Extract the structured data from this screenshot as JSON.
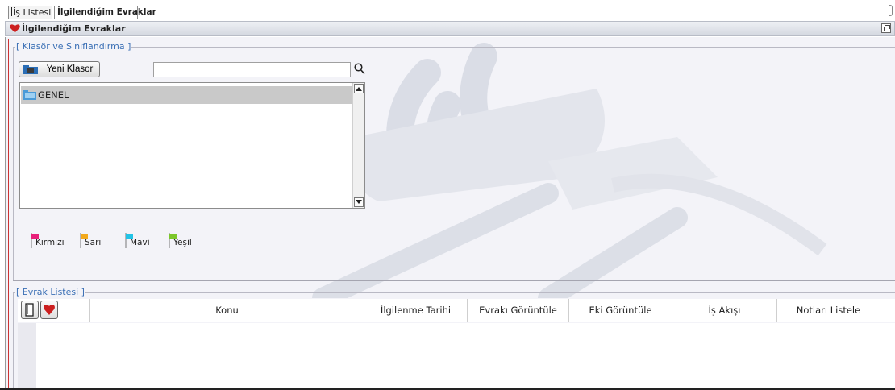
{
  "tabs": [
    {
      "label": "İş Listesi",
      "active": false
    },
    {
      "label": "İlgilendiğim Evraklar",
      "active": true
    }
  ],
  "panel": {
    "title": "İlgilendiğim Evraklar",
    "icon": "heart-icon"
  },
  "folder_section": {
    "label": "[ Klasör ve Sınıflandırma ]",
    "new_folder_button": "Yeni Klasor",
    "search": {
      "value": "",
      "placeholder": ""
    },
    "folders": [
      "GENEL"
    ]
  },
  "flags": [
    {
      "label": "Kırmızı",
      "color": "#e8207a"
    },
    {
      "label": "Sarı",
      "color": "#f2a91c"
    },
    {
      "label": "Mavi",
      "color": "#22c3e6"
    },
    {
      "label": "Yeşil",
      "color": "#7cc72a"
    }
  ],
  "document_section": {
    "label": "[ Evrak Listesi ]",
    "columns": [
      "Konu",
      "İlgilenme Tarihi",
      "Evrakı Görüntüle",
      "Eki Görüntüle",
      "İş Akışı",
      "Notları Listele"
    ],
    "rows": []
  },
  "colors": {
    "section_label": "#3a6fb5",
    "accent_red": "#cc3333"
  }
}
